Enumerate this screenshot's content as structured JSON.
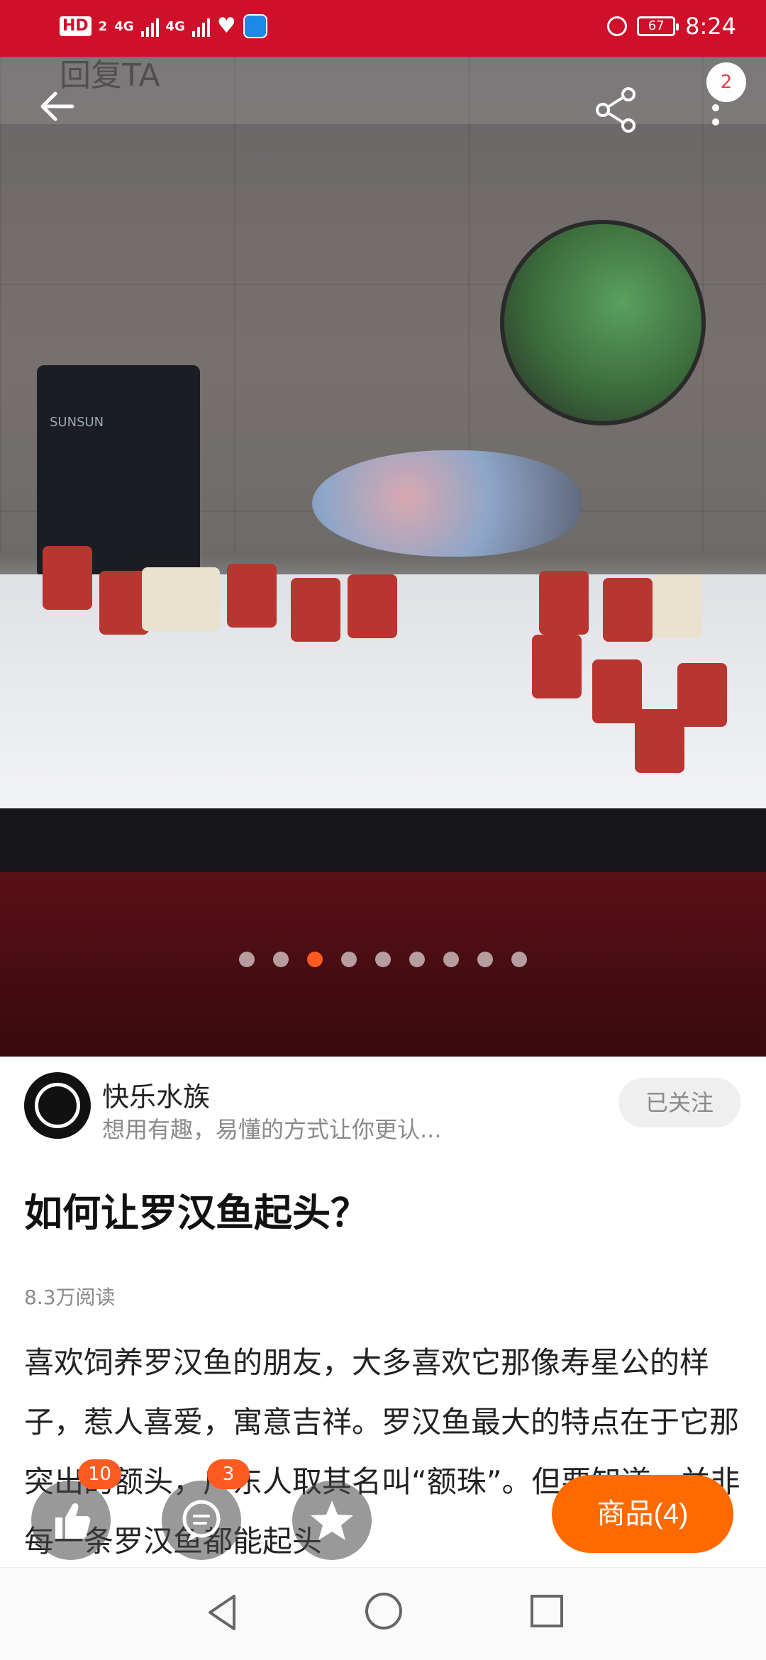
{
  "status_bar": {
    "hd": "HD",
    "sim1": "2",
    "net1": "4G",
    "net2": "4G",
    "battery": "67",
    "time": "8:24"
  },
  "top_bar": {
    "reply_ghost": "回复TA",
    "more_badge": "2"
  },
  "gallery": {
    "dot_count": 9,
    "active_index": 2,
    "photo_text": "SUNSUN"
  },
  "author": {
    "name": "快乐水族",
    "desc": "想用有趣，易懂的方式让你更认...",
    "follow_label": "已关注"
  },
  "article": {
    "title": "如何让罗汉鱼起头？",
    "reads": "8.3万阅读",
    "body": "喜欢饲养罗汉鱼的朋友，大多喜欢它那像寿星公的样子，惹人喜爱，寓意吉祥。罗汉鱼最大的特点在于它那突出的额头，广东人取其名叫“额珠”。但要知道，并非每一条罗汉鱼都能起头"
  },
  "actions": {
    "like_count": "10",
    "comment_count": "3",
    "goods_label": "商品(4)"
  },
  "colors": {
    "status_bar": "#d0102b",
    "accent": "#ff6a00",
    "badge": "#ff5a1f"
  }
}
